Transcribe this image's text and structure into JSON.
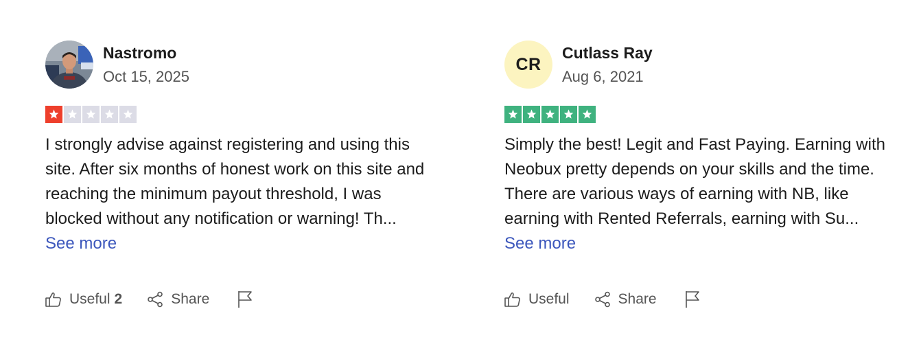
{
  "reviews": [
    {
      "author": "Nastromo",
      "date": "Oct 15, 2025",
      "avatar_type": "photo",
      "rating": 1,
      "rating_color": "#ee3f2c",
      "empty_star_color": "#dcdce6",
      "text": "I strongly advise against registering and using this site. After six months of honest work on this site and reaching the minimum payout threshold, I was blocked without any notification or warning! Th...",
      "see_more": "See more",
      "useful_label": "Useful",
      "useful_count": "2",
      "share_label": "Share"
    },
    {
      "author": "Cutlass Ray",
      "date": "Aug 6, 2021",
      "avatar_type": "initials",
      "initials": "CR",
      "avatar_bg": "#fcf4c0",
      "rating": 5,
      "rating_color": "#3fb27f",
      "empty_star_color": "#dcdce6",
      "text": "Simply the best! Legit and Fast Paying. Earning with Neobux pretty depends on your skills and the time. There are various ways of earning with NB, like earning with Rented Referrals, earning with Su...",
      "see_more": "See more",
      "useful_label": "Useful",
      "share_label": "Share"
    }
  ],
  "icons": {
    "useful": "thumbs-up-icon",
    "share": "share-icon",
    "report": "flag-icon",
    "star": "star-icon"
  }
}
